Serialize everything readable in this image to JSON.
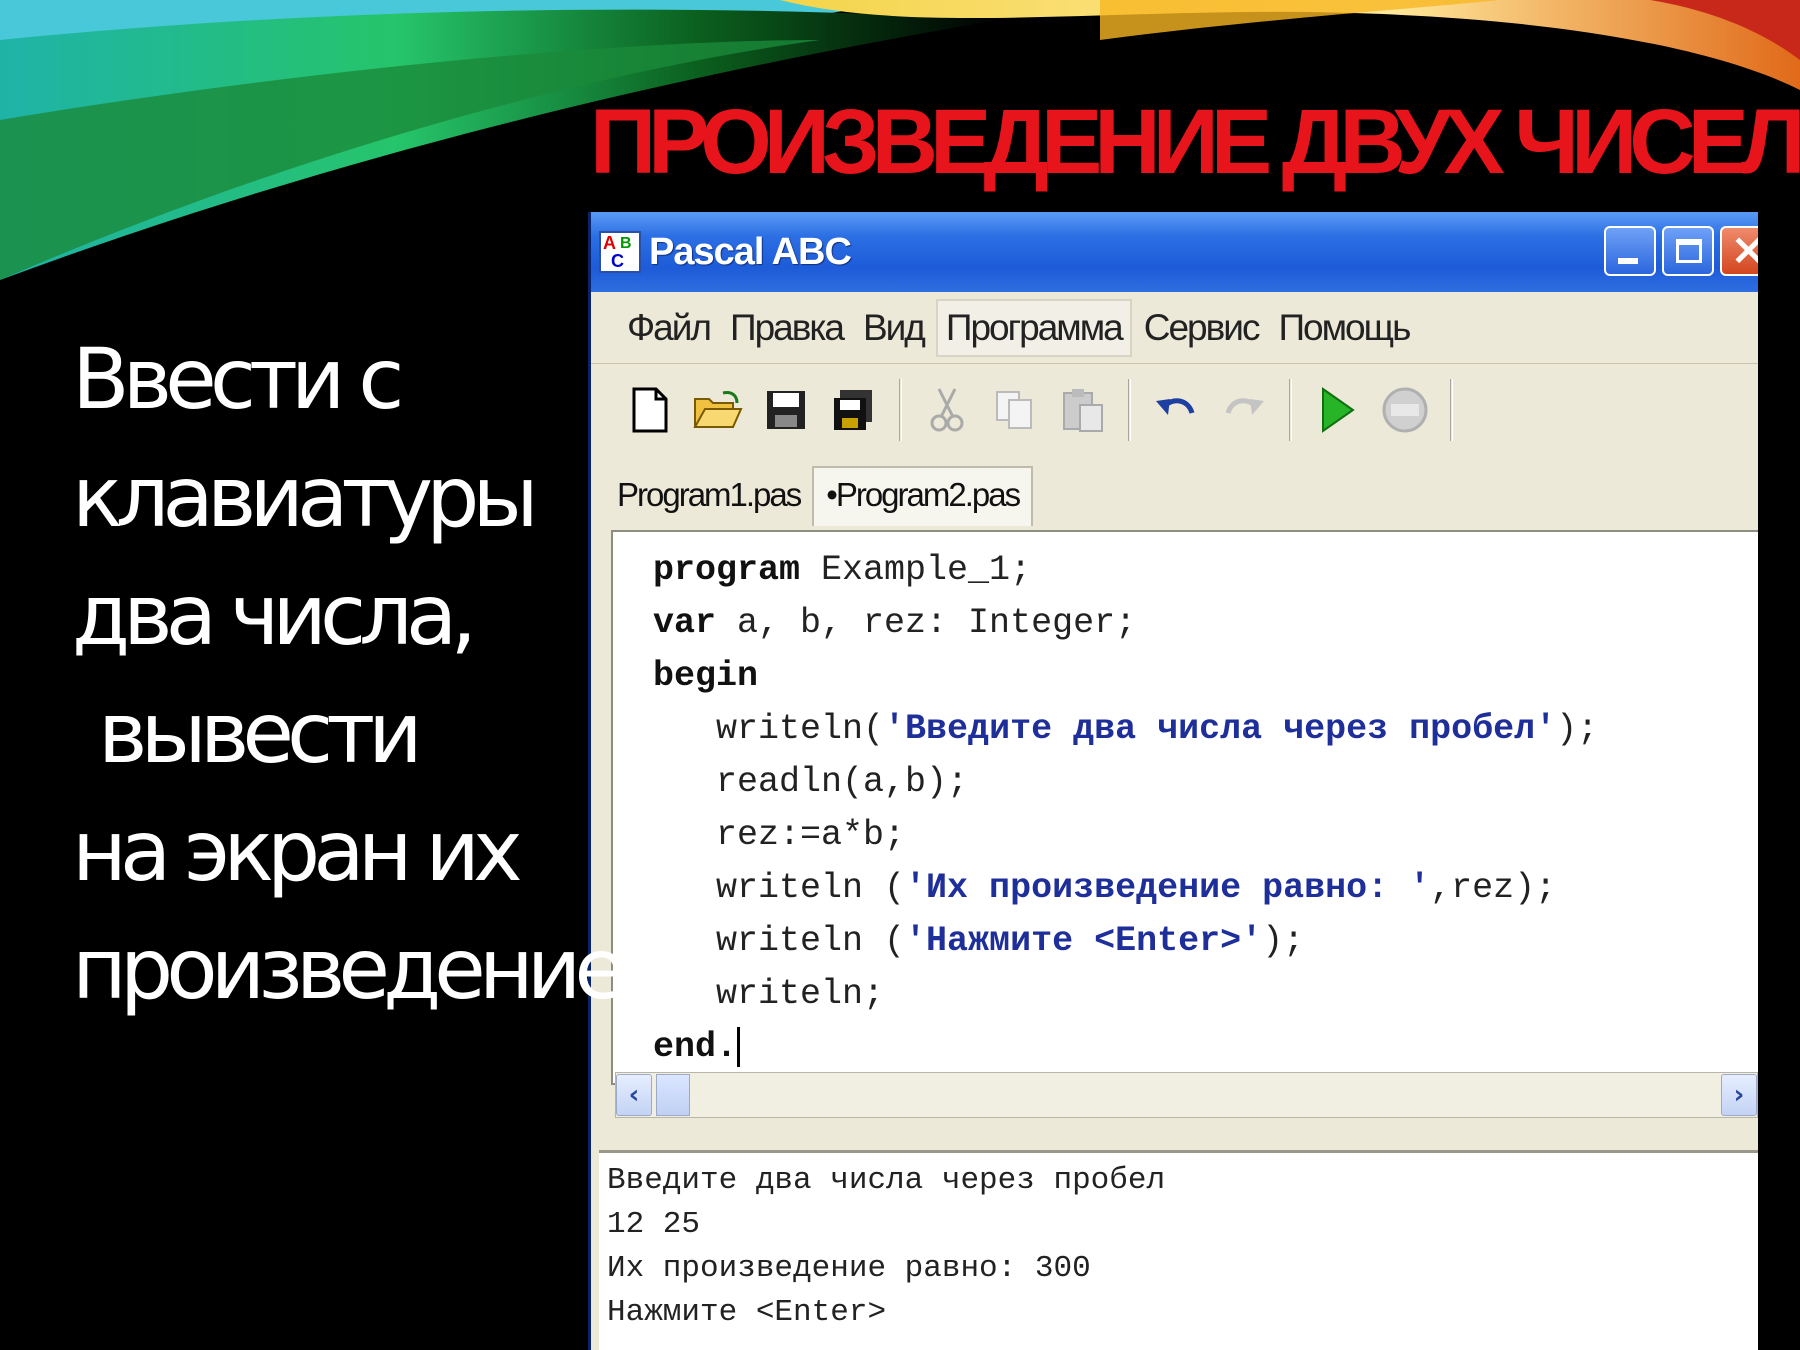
{
  "slide": {
    "title": "ПРОИЗВЕДЕНИЕ ДВУХ ЧИСЕЛ",
    "body_lines": [
      "Ввести с",
      "клавиатуры",
      "два числа,",
      "вывести",
      "на экран их",
      "произведение"
    ]
  },
  "window": {
    "title": "Pascal ABC",
    "icon_letters": [
      "A",
      "B",
      "C"
    ]
  },
  "menu": {
    "items": [
      "Файл",
      "Правка",
      "Вид",
      "Программа",
      "Сервис",
      "Помощь"
    ]
  },
  "toolbar": {
    "buttons": [
      "new-file-icon",
      "open-folder-icon",
      "save-icon",
      "save-all-icon",
      "cut-icon",
      "copy-icon",
      "paste-icon",
      "undo-icon",
      "redo-icon",
      "run-icon",
      "stop-icon"
    ]
  },
  "tabs": [
    "Program1.pas",
    "•Program2.pas"
  ],
  "code": {
    "l1_kw": "program",
    "l1_rest": " Example_1;",
    "l2_kw": "var",
    "l2_rest": " a, b, rez: Integer;",
    "l3_kw": "begin",
    "l4_pre": "   writeln(",
    "l4_str": "'Введите два числа через пробел'",
    "l4_post": ");",
    "l5": "   readln(a,b);",
    "l6": "   rez:=a*b;",
    "l7_pre": "   writeln (",
    "l7_str": "'Их произведение равно: '",
    "l7_post": ",rez);",
    "l8_pre": "   writeln (",
    "l8_str": "'Нажмите <Enter>'",
    "l8_post": ");",
    "l9": "   writeln;",
    "l10_kw": "end."
  },
  "output": {
    "lines": [
      "Введите два числа через пробел",
      "12 25",
      "Их произведение равно: 300",
      "Нажмите <Enter>"
    ]
  },
  "colors": {
    "title_red": "#e8141b",
    "string_blue": "#1f2f9a",
    "titlebar_blue": "#2c6fe4"
  }
}
